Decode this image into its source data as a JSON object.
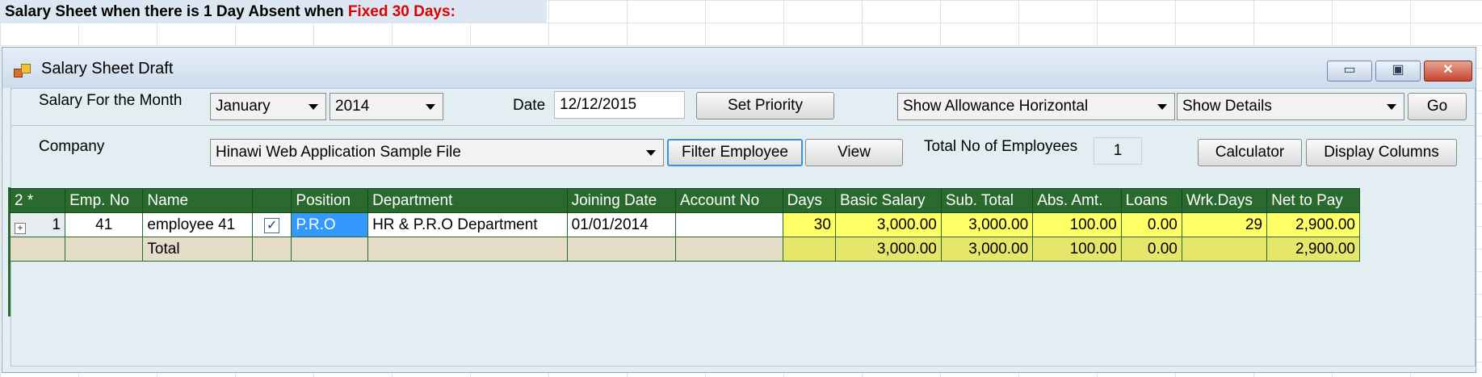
{
  "banner": {
    "text_prefix": "Salary Sheet when there is 1 Day Absent when ",
    "text_highlight": "Fixed 30 Days:"
  },
  "window": {
    "title": "Salary Sheet Draft",
    "controls": {
      "minimize": "▭",
      "maximize": "▣",
      "close": "✕"
    }
  },
  "filters": {
    "salary_month_label": "Salary For the Month",
    "month": "January",
    "year": "2014",
    "date_label": "Date",
    "date_value": "12/12/2015",
    "set_priority_label": "Set Priority",
    "allowance_mode": "Show Allowance Horizontal",
    "details_mode": "Show Details",
    "go_label": "Go",
    "company_label": "Company",
    "company": "Hinawi Web Application Sample File",
    "filter_employee_label": "Filter Employee",
    "view_label": "View",
    "total_employees_label": "Total No of Employees",
    "total_employees": "1",
    "calculator_label": "Calculator",
    "display_columns_label": "Display Columns"
  },
  "grid": {
    "corner": {
      "count": "2",
      "star": "*"
    },
    "columns": [
      "Emp. No",
      "Name",
      "",
      "Position",
      "Department",
      "Joining Date",
      "Account No",
      "Days",
      "Basic Salary",
      "Sub. Total",
      "Abs. Amt.",
      "Loans",
      "Wrk.Days",
      "Net to Pay"
    ],
    "row": {
      "expander": "+",
      "row_number": "1",
      "emp_no": "41",
      "name": "employee 41",
      "checked": "✓",
      "position": "P.R.O",
      "department": "HR & P.R.O Department",
      "joining_date": "01/01/2014",
      "account_no": "",
      "days": "30",
      "basic_salary": "3,000.00",
      "sub_total": "3,000.00",
      "abs_amt": "100.00",
      "loans": "0.00",
      "wrk_days": "29",
      "net_to_pay": "2,900.00"
    },
    "total": {
      "label": "Total",
      "basic_salary": "3,000.00",
      "sub_total": "3,000.00",
      "abs_amt": "100.00",
      "loans": "0.00",
      "net_to_pay": "2,900.00"
    }
  },
  "colors": {
    "header_green": "#2a6a2e",
    "highlight_yellow": "#ffff66",
    "title_red": "#e00000"
  }
}
